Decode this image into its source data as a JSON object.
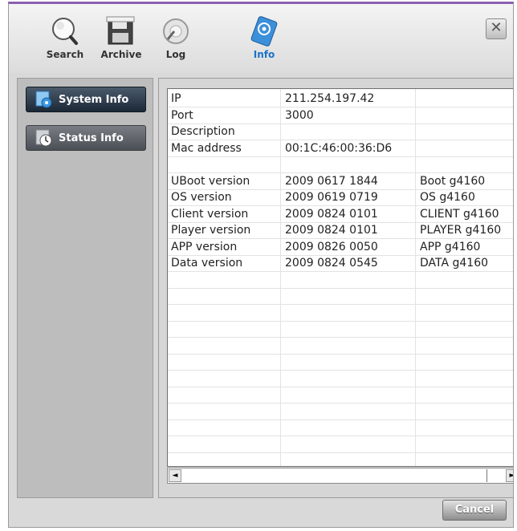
{
  "toolbar": {
    "items": [
      {
        "label": "Search",
        "icon": "magnifier-icon"
      },
      {
        "label": "Archive",
        "icon": "archive-disk-icon"
      },
      {
        "label": "Log",
        "icon": "log-icon"
      },
      {
        "label": "Info",
        "icon": "info-icon",
        "active": true
      }
    ],
    "close_glyph": "✕"
  },
  "sidebar": {
    "items": [
      {
        "label": "System Info",
        "selected": true
      },
      {
        "label": "Status Info",
        "selected": false
      }
    ]
  },
  "info_table": {
    "rows": [
      [
        "IP",
        "211.254.197.42",
        "",
        ""
      ],
      [
        "Port",
        "3000",
        "",
        ""
      ],
      [
        "Description",
        "",
        "",
        ""
      ],
      [
        "Mac address",
        "00:1C:46:00:36:D6",
        "",
        ""
      ],
      [
        "",
        "",
        "",
        ""
      ],
      [
        "UBoot version",
        "2009  0617  1844",
        "Boot g4160",
        ""
      ],
      [
        "OS version",
        "2009  0619  0719",
        "OS g4160",
        ""
      ],
      [
        "Client version",
        "2009  0824  0101",
        "CLIENT g4160",
        ""
      ],
      [
        "Player version",
        "2009  0824  0101",
        "PLAYER g4160",
        ""
      ],
      [
        "APP version",
        "2009  0826  0050",
        "APP g4160",
        ""
      ],
      [
        "Data version",
        "2009  0824  0545",
        "DATA g4160",
        ""
      ]
    ]
  },
  "scrollbar": {
    "left_arrow": "◄",
    "right_arrow": "►"
  },
  "footer": {
    "cancel_label": "Cancel"
  },
  "colors": {
    "accent": "#1c72c8",
    "window_border_top": "#8c5fb0"
  }
}
